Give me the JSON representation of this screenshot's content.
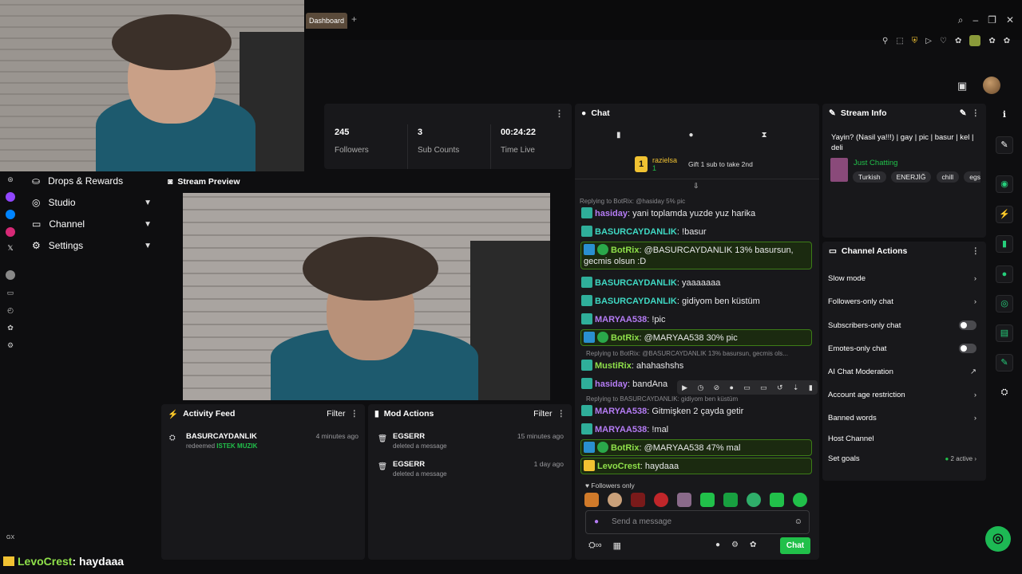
{
  "browser": {
    "tab_label": "Dashboard",
    "new_tab": "+"
  },
  "nav": {
    "items": [
      {
        "label": "Drops & Rewards",
        "has_chevron": false
      },
      {
        "label": "Studio",
        "has_chevron": true
      },
      {
        "label": "Channel",
        "has_chevron": true
      },
      {
        "label": "Settings",
        "has_chevron": true
      }
    ],
    "gx_label": "GX"
  },
  "stats": [
    {
      "value": "245",
      "label": "Followers"
    },
    {
      "value": "3",
      "label": "Sub Counts"
    },
    {
      "value": "00:24:22",
      "label": "Time Live"
    }
  ],
  "preview": {
    "title": "Stream Preview"
  },
  "activity": {
    "title": "Activity Feed",
    "filter": "Filter",
    "items": [
      {
        "user": "BASURCAYDANLIK",
        "action": "redeemed",
        "reward": "ISTEK MUZIK",
        "time": "4 minutes ago"
      }
    ]
  },
  "mod_actions": {
    "title": "Mod Actions",
    "filter": "Filter",
    "items": [
      {
        "user": "EGSERR",
        "action": "deleted a message",
        "time": "15 minutes ago"
      },
      {
        "user": "EGSERR",
        "action": "deleted a message",
        "time": "1 day ago"
      }
    ]
  },
  "chat": {
    "title": "Chat",
    "gifter": {
      "rank": "1",
      "name": "razielsa",
      "count": "1",
      "cta": "Gift 1 sub to take 2nd"
    },
    "top_reply": "Replying to BotRix: @hasiday 5% pic",
    "messages": [
      {
        "user": "hasiday",
        "text": "yani toplamda yuzde yuz harika",
        "color": "#b57cf5"
      },
      {
        "user": "BASURCAYDANLIK",
        "text": "!basur",
        "color": "#3fd9c4"
      },
      {
        "user": "BotRix",
        "text": "@BASURCAYDANLIK 13% basursun, gecmis olsun :D",
        "color": "#8fe04a",
        "highlight": true
      },
      {
        "user": "BASURCAYDANLIK",
        "text": "yaaaaaaa",
        "color": "#3fd9c4"
      },
      {
        "user": "BASURCAYDANLIK",
        "text": "gidiyom ben küstüm",
        "color": "#3fd9c4"
      },
      {
        "user": "MARYAA538",
        "text": "!pic",
        "color": "#b57cf5"
      },
      {
        "user": "BotRix",
        "text": "@MARYAA538 30% pic",
        "color": "#8fe04a",
        "highlight": true
      },
      {
        "user": "MustiRix",
        "text": "ahahashshs",
        "color": "#8fe04a",
        "reply": "Replying to BotRix: @BASURCAYDANLIK 13% basursun, gecmis ols..."
      },
      {
        "user": "hasiday",
        "text": "bandAna",
        "color": "#b57cf5"
      },
      {
        "user": "MARYAA538",
        "text": "Gitmişken 2 çayda getir",
        "color": "#b57cf5",
        "reply": "Replying to BASURCAYDANLIK: gidiyom ben küstüm"
      },
      {
        "user": "MARYAA538",
        "text": "!mal",
        "color": "#b57cf5"
      },
      {
        "user": "BotRix",
        "text": "@MARYAA538 47% mal",
        "color": "#8fe04a",
        "highlight": true
      },
      {
        "user": "LevoCrest",
        "text": "haydaaa",
        "color": "#8fe04a",
        "highlight": true
      }
    ],
    "followers_only": "Followers only",
    "placeholder": "Send a message",
    "send_label": "Chat"
  },
  "stream_info": {
    "title": "Stream Info",
    "stream_title": "Yayin? (Nasil ya!!!) | gay | pic | basur | kel | deli",
    "category": "Just Chatting",
    "tags": [
      "Turkish",
      "ENERJİĞ",
      "chill",
      "egsert"
    ]
  },
  "channel_actions": {
    "title": "Channel Actions",
    "items": [
      {
        "label": "Slow mode",
        "control": "chevron"
      },
      {
        "label": "Followers-only chat",
        "control": "chevron"
      },
      {
        "label": "Subscribers-only chat",
        "control": "toggle"
      },
      {
        "label": "Emotes-only chat",
        "control": "toggle"
      },
      {
        "label": "AI Chat Moderation",
        "control": "external"
      },
      {
        "label": "Account age restriction",
        "control": "chevron"
      },
      {
        "label": "Banned words",
        "control": "chevron"
      },
      {
        "label": "Host Channel",
        "control": "none"
      },
      {
        "label": "Set goals",
        "control": "chevron",
        "status": "2 active"
      }
    ]
  },
  "overlay": {
    "user": "LevoCrest",
    "text": ": haydaaa"
  },
  "colors": {
    "accent": "#21c04a",
    "bg": "#0e0e10",
    "panel": "#18181b"
  }
}
